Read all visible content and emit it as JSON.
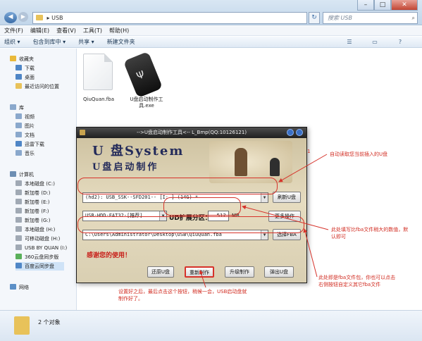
{
  "explorer": {
    "breadcrumb": "USB",
    "search_placeholder": "搜索 USB",
    "menu": [
      "文件(F)",
      "编辑(E)",
      "查看(V)",
      "工具(T)",
      "帮助(H)"
    ],
    "toolbar": [
      "组织 ▾",
      "包含到库中 ▾",
      "共享 ▾",
      "新建文件夹"
    ],
    "nav": {
      "favorites_header": "收藏夹",
      "favorites": [
        "下载",
        "桌面",
        "最近访问的位置"
      ],
      "library_header": "库",
      "libraries": [
        "视频",
        "图片",
        "文档",
        "迅雷下载",
        "音乐"
      ],
      "computer_header": "计算机",
      "drives": [
        "本地磁盘 (C:)",
        "新加卷 (D:)",
        "新加卷 (E:)",
        "新加卷 (F:)",
        "新加卷 (G:)",
        "本地磁盘 (H:)",
        "可移动磁盘 (H:)",
        "USB BY QUAN (I:)",
        "360云盘同步版",
        "百度云同步盘"
      ],
      "network": "网络"
    },
    "files": [
      {
        "name": "QiuQuan.fba",
        "icon": "document-icon"
      },
      {
        "name": "U盘启动制作工具.exe",
        "icon": "usb-drive-icon"
      }
    ],
    "status": "2 个对象"
  },
  "tool": {
    "title": "-->U盘启动制作工具<-- L_Bmp(QQ:10126121)",
    "logo_line1": "U 盘System",
    "logo_line2": "U盘启动制作",
    "device_select": "(hd2): USB_SSK--SFD201-- [I: ] (14G) *",
    "refresh_btn": "刷新U盘",
    "format_select": "USB-HDD-FAT32-[推荐]",
    "ud_label": "UD扩展分区：",
    "ud_value": "512",
    "ud_unit": "MB",
    "more_btn": "更多操作",
    "path_value": "C:\\Users\\Administrator\\Desktop\\USB\\QiuQuan.fba",
    "select_fba_btn": "选择FBA",
    "thanks": "感谢您的使用！",
    "buttons": [
      "还原U盘",
      "重新制作",
      "升级制作",
      "弹出U盘"
    ]
  },
  "annotations": {
    "marker_1": "1",
    "auto_read": "自动读取您当前插入的U盘",
    "size_note_1": "此处填写比fba文件稍大的数值，默",
    "size_note_2": "认即可",
    "fba_note_1": "此处即是fba文件包，你也可以点击",
    "fba_note_2": "右侧按钮自定义其它fba文件",
    "bottom_note_1": "设置好之后，最后点击这个按钮，稍候一会，USB启动盘就",
    "bottom_note_2": "制作好了。",
    "color": "#d6322a"
  }
}
